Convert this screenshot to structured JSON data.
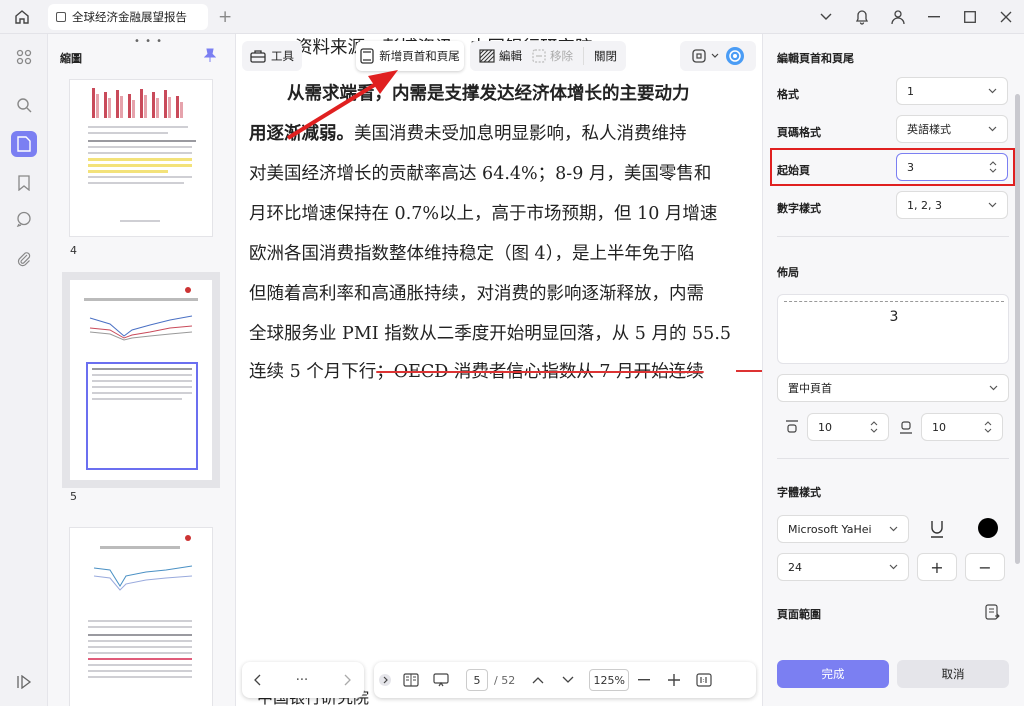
{
  "titlebar": {
    "tab_title": "全球经济金融展望报告",
    "add_tab": "+"
  },
  "thumbnails": {
    "title": "縮圖",
    "page_labels": [
      "4",
      "5"
    ]
  },
  "document": {
    "lines": [
      {
        "text": "资料来源：彭博资讯，中国银行研究院",
        "bold": false
      },
      {
        "text": "从需求端看，内需是支撑发达经济体增长的主要动力",
        "bold": true
      },
      {
        "text_bold": "用逐渐减弱。",
        "text_rest": "美国消费未受加息明显影响，私人消费维持"
      },
      {
        "text": "对美国经济增长的贡献率高达 64.4%；8-9 月，美国零售和"
      },
      {
        "text": "月环比增速保持在 0.7%以上，高于市场预期，但 10 月增速"
      },
      {
        "text": "欧洲各国消费指数整体维持稳定（图 4），是上半年免于陷"
      },
      {
        "text": "但随着高利率和高通胀持续，对消费的影响逐渐释放，内需"
      },
      {
        "text": "全球服务业 PMI 指数从二季度开始明显回落，从 5 月的 55.5"
      },
      {
        "text_plain": "连续 5 个月下行",
        "text_strike": "；OECD 消费者信心指数从 7 月开始连续"
      }
    ],
    "footer_fragment": "中国银行研究院"
  },
  "toolbar": {
    "tools_label": "工具",
    "add_header_footer_label": "新增頁首和頁尾",
    "edit_label": "編輯",
    "remove_label": "移除",
    "close_label": "關閉"
  },
  "bottom": {
    "more": "···",
    "current_page": "5",
    "total_pages": "/ 52",
    "zoom": "125%"
  },
  "panel": {
    "title": "編輯頁首和頁尾",
    "format_label": "格式",
    "format_value": "1",
    "page_format_label": "頁碼格式",
    "page_format_value": "英語樣式",
    "start_page_label": "起始頁",
    "start_page_value": "3",
    "number_style_label": "數字樣式",
    "number_style_value": "1, 2, 3",
    "layout_label": "佈局",
    "preview_number": "3",
    "position_value": "置中頁首",
    "margin_top_value": "10",
    "margin_bottom_value": "10",
    "font_style_label": "字體樣式",
    "font_family_value": "Microsoft YaHei",
    "font_size_value": "24",
    "plus": "+",
    "minus": "−",
    "page_range_label": "頁面範圍",
    "done_label": "完成",
    "cancel_label": "取消",
    "accent_color": "#7b7ff2",
    "highlight_color": "#e02020"
  }
}
